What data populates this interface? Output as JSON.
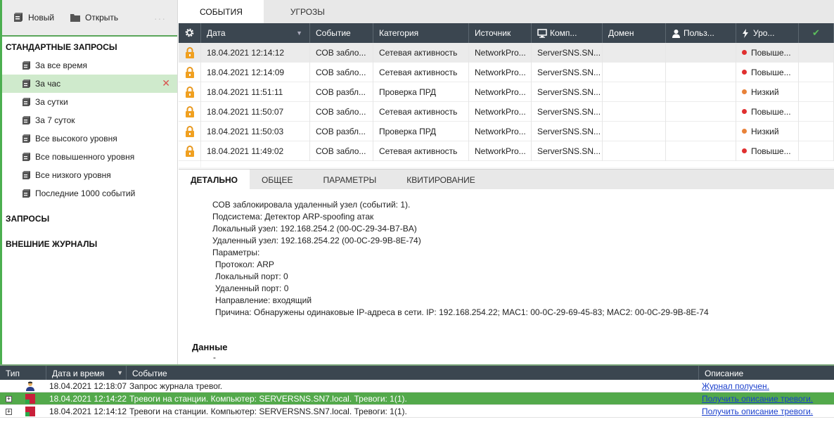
{
  "toolbar": {
    "new_label": "Новый",
    "open_label": "Открыть",
    "more": "···"
  },
  "left": {
    "section_standard": "СТАНДАРТНЫЕ ЗАПРОСЫ",
    "items": [
      {
        "label": "За все время"
      },
      {
        "label": "За час",
        "active": true
      },
      {
        "label": "За сутки"
      },
      {
        "label": "За 7 суток"
      },
      {
        "label": "Все высокого уровня"
      },
      {
        "label": "Все повышенного уровня"
      },
      {
        "label": "Все низкого уровня"
      },
      {
        "label": "Последние 1000 событий"
      }
    ],
    "section_queries": "ЗАПРОСЫ",
    "section_external": "ВНЕШНИЕ ЖУРНАЛЫ"
  },
  "tabs": [
    {
      "label": "СОБЫТИЯ"
    },
    {
      "label": "УГРОЗЫ"
    }
  ],
  "grid": {
    "headers": [
      "Дата",
      "Событие",
      "Категория",
      "Источник",
      "Комп...",
      "Домен",
      "Польз...",
      "Уро..."
    ],
    "rows": [
      {
        "date": "18.04.2021 12:14:12",
        "event": "СОВ забло...",
        "category": "Сетевая активность",
        "source": "NetworkPro...",
        "comp": "ServerSNS.SN...",
        "domain": "",
        "user": "",
        "level": "Повыше...",
        "level_color": "#e03030"
      },
      {
        "date": "18.04.2021 12:14:09",
        "event": "СОВ забло...",
        "category": "Сетевая активность",
        "source": "NetworkPro...",
        "comp": "ServerSNS.SN...",
        "domain": "",
        "user": "",
        "level": "Повыше...",
        "level_color": "#e03030"
      },
      {
        "date": "18.04.2021 11:51:11",
        "event": "СОВ разбл...",
        "category": "Проверка ПРД",
        "source": "NetworkPro...",
        "comp": "ServerSNS.SN...",
        "domain": "",
        "user": "",
        "level": "Низкий",
        "level_color": "#e8823a"
      },
      {
        "date": "18.04.2021 11:50:07",
        "event": "СОВ забло...",
        "category": "Сетевая активность",
        "source": "NetworkPro...",
        "comp": "ServerSNS.SN...",
        "domain": "",
        "user": "",
        "level": "Повыше...",
        "level_color": "#e03030"
      },
      {
        "date": "18.04.2021 11:50:03",
        "event": "СОВ разбл...",
        "category": "Проверка ПРД",
        "source": "NetworkPro...",
        "comp": "ServerSNS.SN...",
        "domain": "",
        "user": "",
        "level": "Низкий",
        "level_color": "#e8823a"
      },
      {
        "date": "18.04.2021 11:49:02",
        "event": "СОВ забло...",
        "category": "Сетевая активность",
        "source": "NetworkPro...",
        "comp": "ServerSNS.SN...",
        "domain": "",
        "user": "",
        "level": "Повыше...",
        "level_color": "#e03030"
      }
    ]
  },
  "detail_tabs": [
    {
      "label": "ДЕТАЛЬНО"
    },
    {
      "label": "ОБЩЕЕ"
    },
    {
      "label": "ПАРАМЕТРЫ"
    },
    {
      "label": "КВИТИРОВАНИЕ"
    }
  ],
  "detail": {
    "lines": [
      "СОВ заблокировала удаленный узел (событий: 1).",
      "Подсистема: Детектор ARP-spoofing атак",
      "Локальный узел: 192.168.254.2 (00-0C-29-34-B7-BA)",
      "Удаленный узел: 192.168.254.22 (00-0C-29-9B-8E-74)",
      "Параметры:",
      "Протокол: ARP",
      "Локальный порт: 0",
      "Удаленный порт: 0",
      "Направление: входящий",
      "Причина: Обнаружены одинаковые IP-адреса в сети. IP: 192.168.254.22; MAC1: 00-0C-29-69-45-83; MAC2: 00-0C-29-9B-8E-74"
    ],
    "data_heading": "Данные",
    "data_value": "-"
  },
  "log": {
    "headers": [
      "Тип",
      "Дата и время",
      "Событие",
      "Описание"
    ],
    "rows": [
      {
        "time": "18.04.2021 12:18:07",
        "event": "Запрос журнала тревог.",
        "desc": "Журнал получен."
      },
      {
        "time": "18.04.2021 12:14:22",
        "event": "Тревоги на станции. Компьютер: SERVERSNS.SN7.local. Тревоги: 1(1).",
        "desc": "Получить описание тревоги.",
        "expand": "+"
      },
      {
        "time": "18.04.2021 12:14:12",
        "event": "Тревоги на станции. Компьютер: SERVERSNS.SN7.local. Тревоги: 1(1).",
        "desc": "Получить описание тревоги.",
        "expand": "+"
      }
    ]
  },
  "colors": {
    "accent_green": "#53a94b",
    "header_dark": "#3b4650",
    "level_high": "#e03030",
    "level_low": "#e8823a",
    "lock": "#f0a020"
  }
}
